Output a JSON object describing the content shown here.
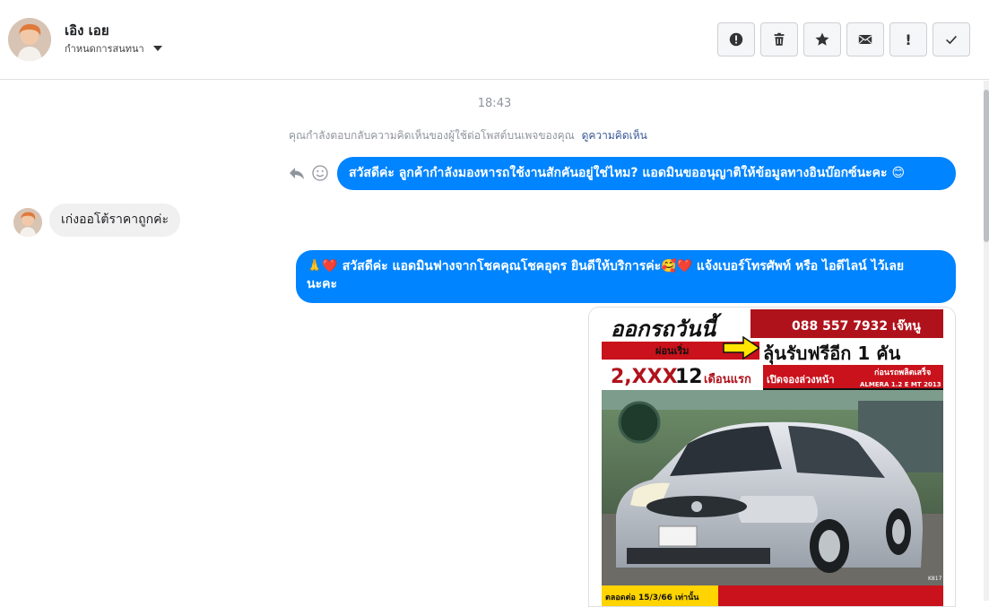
{
  "header": {
    "name": "เอิง เอย",
    "subtitle": "กำหนดการสนทนา"
  },
  "toolbar": {
    "buttons": [
      {
        "icon": "alert-circle-icon"
      },
      {
        "icon": "trash-icon"
      },
      {
        "icon": "star-icon"
      },
      {
        "icon": "envelope-icon"
      },
      {
        "label": "!"
      },
      {
        "icon": "check-icon"
      }
    ]
  },
  "conversation": {
    "timestamp": "18:43",
    "notice_text": "คุณกำลังตอบกลับความคิดเห็นของผู้ใช้ต่อโพสต์บนเพจของคุณ",
    "notice_link": "ดูความคิดเห็น",
    "messages": [
      {
        "from": "page",
        "text": "สวัสดีค่ะ ลูกค้ากำลังมองหารถใช้งานสักคันอยู่ใช่ไหม? แอดมินขออนุญาติให้ข้อมูลทางอินบ๊อกซ์นะคะ 😊"
      },
      {
        "from": "user",
        "text": "เก่งออโต้ราคาถูกค่ะ"
      },
      {
        "from": "page",
        "line1": "🙏❤️ สวัสดีค่ะ แอดมินฟางจากโชคคุณโชคอุดร ยินดีให้บริการค่ะ🥰❤️ แจ้งเบอร์โทรศัพท์ หรือ ไอดีไลน์  ไว้เลย",
        "line2": "นะคะ"
      }
    ],
    "image_ad": {
      "headline": "ออกรถวันนี้",
      "phone": "088 557 7932 เจ๊หนู",
      "promo": "ลุ้นรับฟรีอีก 1 คัน",
      "start": "ผ่อนเริ่ม",
      "price": "2,XXX",
      "months": "12",
      "months_label": "เดือนแรก",
      "booking": "เปิดจองล่วงหน้า",
      "ready": "ก่อนรถพลิตเสร็จ",
      "model": "ALMERA 1.2 E MT 2013",
      "plate_code": "K817",
      "footer": "ตลอดต่อ 15/3/66 เท่านั้น"
    }
  }
}
